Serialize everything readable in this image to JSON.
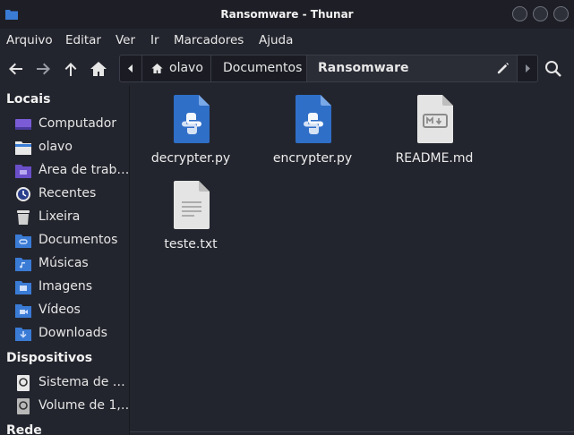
{
  "window": {
    "title": "Ransomware - Thunar"
  },
  "menu": [
    "Arquivo",
    "Editar",
    "Ver",
    "Ir",
    "Marcadores",
    "Ajuda"
  ],
  "toolbar": {
    "back_icon": "arrow-left-icon",
    "forward_icon": "arrow-right-icon",
    "up_icon": "arrow-up-icon",
    "home_icon": "home-icon",
    "search_icon": "search-icon"
  },
  "path": {
    "crumbs": [
      "olavo",
      "Documentos",
      "Ransomware"
    ],
    "active": "Ransomware"
  },
  "sidebar": {
    "locais_title": "Locais",
    "locais": [
      {
        "label": "Computador",
        "icon": "computer-icon"
      },
      {
        "label": "olavo",
        "icon": "home-folder-icon"
      },
      {
        "label": "Área de trab…",
        "icon": "desktop-folder-icon"
      },
      {
        "label": "Recentes",
        "icon": "recent-icon"
      },
      {
        "label": "Lixeira",
        "icon": "trash-icon"
      },
      {
        "label": "Documentos",
        "icon": "documents-folder-icon"
      },
      {
        "label": "Músicas",
        "icon": "music-folder-icon"
      },
      {
        "label": "Imagens",
        "icon": "pictures-folder-icon"
      },
      {
        "label": "Vídeos",
        "icon": "videos-folder-icon"
      },
      {
        "label": "Downloads",
        "icon": "downloads-folder-icon"
      }
    ],
    "dispositivos_title": "Dispositivos",
    "dispositivos": [
      {
        "label": "Sistema de …",
        "icon": "drive-icon"
      },
      {
        "label": "Volume de 1,…",
        "icon": "drive-icon"
      }
    ],
    "rede_title": "Rede"
  },
  "files": [
    {
      "name": "decrypter.py",
      "icon": "python-file-icon"
    },
    {
      "name": "encrypter.py",
      "icon": "python-file-icon"
    },
    {
      "name": "README.md",
      "icon": "markdown-file-icon"
    },
    {
      "name": "teste.txt",
      "icon": "text-file-icon"
    }
  ],
  "colors": {
    "accent": "#3a7bd5",
    "background": "#23252e",
    "titlebar": "#1e1f26"
  }
}
